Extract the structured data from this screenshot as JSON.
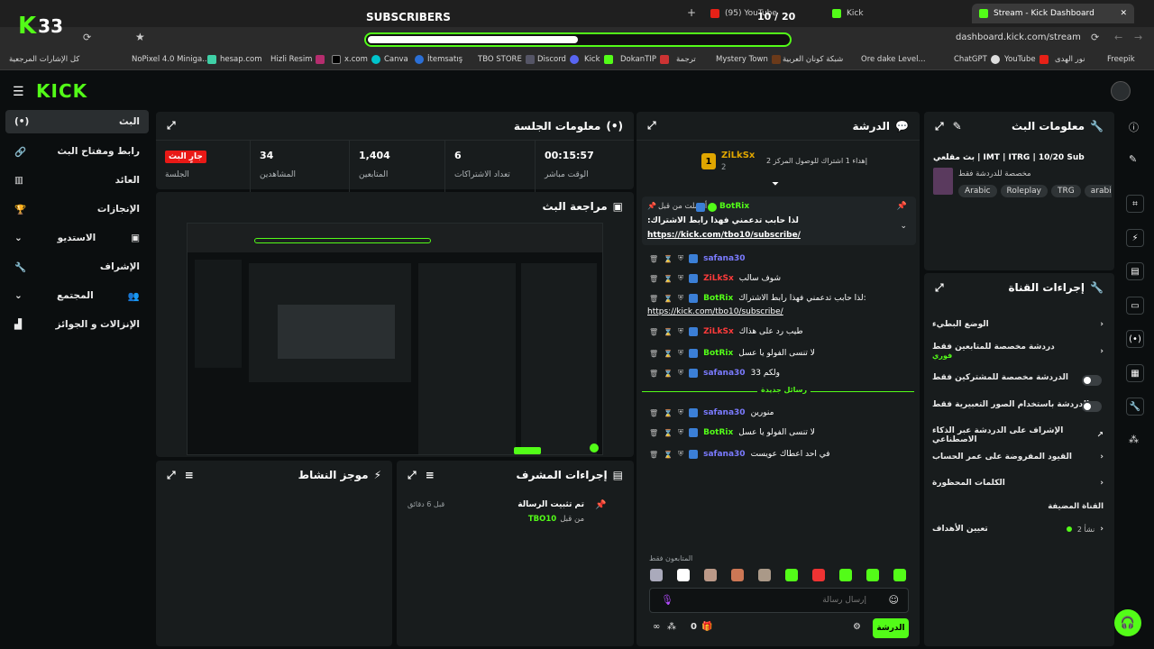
{
  "browser": {
    "tabs": [
      {
        "label": "(95) YouTube"
      },
      {
        "label": "Kick"
      },
      {
        "label": "Stream - Kick Dashboard"
      }
    ],
    "url": "dashboard.kick.com/stream",
    "bookmarks": [
      "كل الإشارات المرجعية",
      "NoPixel 4.0 Miniga...",
      "hesap.com",
      "Hizli Resim",
      "x.com",
      "Canva",
      "İtemsatış",
      "TBO STORE",
      "Discord",
      "Kick",
      "DokanTIP",
      "ترجمة",
      "Mystery Town",
      "شبكة كونان العربية",
      "Ore dake Level...",
      "ChatGPT",
      "YouTube",
      "نور الهدى",
      "Freepik"
    ]
  },
  "overlay": {
    "logo_text": "33",
    "goal_label": "SUBSCRIBERS",
    "goal_count": "10 / 20",
    "goal_progress": 0.5
  },
  "sidebar": {
    "items": [
      {
        "label": "البث"
      },
      {
        "label": "رابط ومفتاح البث"
      },
      {
        "label": "العائد"
      },
      {
        "label": "الإنجازات"
      },
      {
        "label": "الاستديو"
      },
      {
        "label": "الإشراف"
      },
      {
        "label": "المجتمع"
      },
      {
        "label": "الإنزالات و الجوائز"
      }
    ]
  },
  "session": {
    "title": "معلومات الجلسة",
    "live_badge": "جارٍ البث",
    "session_label": "الجلسة",
    "stats": [
      {
        "value": "34",
        "label": "المشاهدين"
      },
      {
        "value": "1,404",
        "label": "المتابعين"
      },
      {
        "value": "6",
        "label": "تعداد الاشتراكات"
      },
      {
        "value": "00:15:57",
        "label": "الوقت مباشر"
      }
    ]
  },
  "preview": {
    "title": "مراجعة البث"
  },
  "activity": {
    "title": "موجز النشاط"
  },
  "modactions": {
    "title": "إجراءات المشرف",
    "entry_title": "تم تثبيت الرسالة",
    "entry_by": "من قبل",
    "entry_user": "TBO10",
    "entry_time": "قبل 6 دقائق"
  },
  "chat": {
    "title": "الدرشة",
    "top_user": "ZiLkSx",
    "top_user_count": "2",
    "top_note": "إهداء 1 اشتراك للوصول المركز 2",
    "pinned_by": "أرسلت من قبل",
    "pinned_user": "BotRix",
    "pinned_text": ":لذا حابب تدعمني فهذا رابط الاشتراك",
    "pinned_link": "https://kick.com/tbo10/subscribe/",
    "messages": [
      {
        "user": "safana30",
        "text": ""
      },
      {
        "user": "ZiLkSx",
        "text": "شوف سالب"
      },
      {
        "user": "BotRix",
        "text": "لذا حابب تدعمني فهذا رابط الاشتراك:"
      },
      {
        "user": "",
        "text": "https://kick.com/tbo10/subscribe/"
      },
      {
        "user": "ZiLkSx",
        "text": "طيب رد على هذاك"
      },
      {
        "user": "BotRix",
        "text": "لا تنسى الفولو يا عسل"
      },
      {
        "user": "safana30",
        "text": "ولكم 33"
      },
      {
        "user": "safana30",
        "text": "منورين"
      },
      {
        "user": "BotRix",
        "text": "لا تنسى الفولو يا عسل"
      },
      {
        "user": "safana30",
        "text": "في احد اعطاك عويست"
      }
    ],
    "new_messages": "رسائل جديدة",
    "followers_only": "المتابعون فقط",
    "input_placeholder": "إرسال رسالة",
    "count": "0",
    "send_label": "الدرشة"
  },
  "streaminfo": {
    "title": "معلومات البث",
    "stream_title": "بث مقلعي | IMT | ITRG | 10/20 Sub",
    "category": "مخصصة للدردشة فقط",
    "tags": [
      "Arabic",
      "Roleplay",
      "TRG",
      "arabi"
    ]
  },
  "channel": {
    "title": "إجراءات القناة",
    "rows": [
      {
        "label": "الوضع البطيء"
      },
      {
        "label": "دردشة مخصصة للمتابعين فقط",
        "sub": "فوري"
      },
      {
        "label": "الدردشة مخصصة للمشتركين فقط"
      },
      {
        "label": "الدردشة باستخدام الصور التعبيرية فقط"
      },
      {
        "label": "الإشراف على الدردشة عبر الذكاء الاصطناعي"
      },
      {
        "label": "القيود المفروضة على عمر الحساب"
      },
      {
        "label": "الكلمات المحظورة"
      }
    ],
    "pinned_channel": "القناة المضيفة",
    "targets_label": "تعيين الأهداف",
    "targets_value": "نشأ 2"
  },
  "colors": {
    "accent": "#53fc18",
    "live": "#e91916",
    "bg": "#0b0e0f",
    "panel": "#181c1d"
  }
}
